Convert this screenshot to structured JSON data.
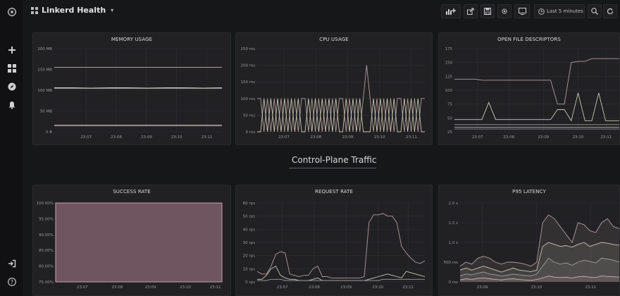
{
  "app": {
    "dashboard_title": "Linkerd Health",
    "time_picker_label": "Last 5 minutes"
  },
  "colors": {
    "background": "#161719",
    "panel": "#212124",
    "line_primary": "#b89a9a",
    "line_secondary": "#c9c9b0",
    "line_tertiary": "#9e9e9e",
    "success_fill": "#6e5560"
  },
  "icons": {
    "sidebar_top": "grafana-logo-icon",
    "sidebar": [
      "plus-icon",
      "dashboards-icon",
      "explore-compass-icon",
      "bell-alert-icon"
    ],
    "sidebar_bottom": [
      "sign-in-icon",
      "help-icon"
    ],
    "navbar": [
      "add-panel-icon",
      "share-icon",
      "save-icon",
      "settings-gear-icon",
      "tv-mode-icon",
      "clock-icon",
      "zoom-out-icon",
      "refresh-icon"
    ]
  },
  "row": {
    "title": "Control-Plane Traffic"
  },
  "panels": [
    {
      "title": "MEMORY USAGE",
      "chart_data": {
        "type": "line",
        "x_ticks": [
          "23:07",
          "23:08",
          "23:09",
          "23:10",
          "23:11"
        ],
        "y_ticks": [
          "0 B",
          "50 MB",
          "100 MB",
          "150 MB",
          "200 MB"
        ],
        "ylim": [
          0,
          200
        ],
        "series": [
          {
            "values": [
              155,
              155,
              155,
              155,
              155,
              155,
              155,
              155,
              155,
              155
            ]
          },
          {
            "values": [
              106,
              106,
              105,
              106,
              106,
              105,
              106,
              106,
              105,
              106
            ]
          },
          {
            "values": [
              104,
              104,
              104,
              104,
              104,
              104,
              104,
              104,
              104,
              104
            ]
          },
          {
            "values": [
              16,
              16,
              16,
              16,
              16,
              16,
              16,
              16,
              16,
              16
            ]
          },
          {
            "values": [
              14,
              14,
              14,
              14,
              14,
              14,
              14,
              14,
              14,
              14
            ]
          }
        ]
      }
    },
    {
      "title": "CPU USAGE",
      "chart_data": {
        "type": "line",
        "x_ticks": [
          "23:07",
          "23:08",
          "23:09",
          "23:10",
          "23:11"
        ],
        "y_ticks": [
          "0 ms",
          "50 ms",
          "100 ms",
          "150 ms",
          "200 ms",
          "250 ms"
        ],
        "ylim": [
          0,
          250
        ],
        "series": [
          {
            "values": [
              100,
              100,
              0,
              100,
              0,
              100,
              0,
              100,
              0,
              100,
              0,
              100,
              0,
              100,
              100,
              0,
              100,
              0,
              100,
              0,
              100,
              0,
              100,
              0,
              100,
              100,
              0,
              100,
              0,
              100,
              0,
              100,
              200,
              100,
              0,
              100,
              0,
              100,
              0,
              100,
              0,
              100,
              100,
              0,
              100,
              0,
              100,
              0,
              100,
              100
            ]
          },
          {
            "values": [
              0,
              0,
              100,
              0,
              100,
              0,
              100,
              0,
              100,
              0,
              100,
              0,
              100,
              0,
              0,
              100,
              0,
              100,
              0,
              100,
              0,
              100,
              0,
              100,
              0,
              0,
              100,
              0,
              100,
              0,
              100,
              0,
              0,
              0,
              100,
              0,
              100,
              0,
              100,
              0,
              100,
              0,
              0,
              100,
              0,
              100,
              0,
              100,
              0,
              0
            ]
          }
        ]
      }
    },
    {
      "title": "OPEN FILE DESCRIPTORS",
      "chart_data": {
        "type": "line",
        "x_ticks": [
          "23:07",
          "23:08",
          "23:09",
          "23:10",
          "23:11"
        ],
        "y_ticks": [
          "25",
          "50",
          "75",
          "100",
          "125",
          "150",
          "175"
        ],
        "ylim": [
          25,
          175
        ],
        "series": [
          {
            "values": [
              120,
              120,
              120,
              120,
              118,
              118,
              118,
              118,
              118,
              118,
              118,
              118,
              118,
              118,
              118,
              75,
              75,
              150,
              152,
              152,
              157,
              157,
              157,
              157,
              157
            ]
          },
          {
            "values": [
              47,
              47,
              47,
              47,
              47,
              78,
              47,
              47,
              47,
              47,
              47,
              47,
              47,
              47,
              47,
              65,
              65,
              45,
              95,
              45,
              45,
              95,
              45,
              45,
              45
            ]
          },
          {
            "values": [
              38,
              38,
              38,
              38,
              38,
              38,
              38,
              38,
              38,
              38,
              38,
              38,
              38,
              38,
              38,
              38,
              38,
              38,
              38,
              38,
              38,
              38,
              38,
              38,
              38
            ]
          },
          {
            "values": [
              33,
              33,
              33,
              33,
              33,
              33,
              33,
              33,
              33,
              33,
              33,
              33,
              33,
              33,
              33,
              33,
              33,
              33,
              33,
              33,
              33,
              33,
              33,
              33,
              33
            ]
          },
          {
            "values": [
              30,
              30,
              30,
              30,
              30,
              30,
              30,
              30,
              30,
              30,
              30,
              30,
              30,
              30,
              30,
              30,
              30,
              30,
              30,
              30,
              30,
              30,
              30,
              30,
              30
            ]
          }
        ]
      }
    },
    {
      "title": "SUCCESS RATE",
      "chart_data": {
        "type": "area",
        "x_ticks": [
          "23:07",
          "23:08",
          "23:09",
          "23:10",
          "23:11"
        ],
        "y_ticks": [
          "75.00%",
          "80.00%",
          "85.00%",
          "90.00%",
          "95.00%",
          "100.00%"
        ],
        "ylim": [
          75,
          100
        ],
        "series": [
          {
            "values": [
              100,
              100,
              100,
              100,
              100,
              100,
              100,
              100,
              100,
              100
            ]
          }
        ]
      }
    },
    {
      "title": "REQUEST RATE",
      "chart_data": {
        "type": "line",
        "x_ticks": [
          "23:07",
          "23:08",
          "23:09",
          "23:10",
          "23:11"
        ],
        "y_ticks": [
          "0 rps",
          "10 rps",
          "20 rps",
          "30 rps",
          "40 rps",
          "50 rps",
          "60 rps"
        ],
        "ylim": [
          0,
          60
        ],
        "series": [
          {
            "values": [
              8,
              6,
              6,
              12,
              21,
              23,
              22,
              6,
              5,
              4,
              5,
              5,
              10,
              12,
              4,
              4,
              3,
              3,
              3,
              3,
              3,
              3,
              3,
              4,
              45,
              51,
              51,
              52,
              50,
              50,
              45,
              27,
              22,
              18,
              15,
              14,
              16
            ]
          },
          {
            "values": [
              2,
              2,
              5,
              10,
              12,
              5,
              3,
              2,
              2,
              1,
              1,
              1,
              2,
              3,
              1,
              1,
              1,
              1,
              1,
              1,
              1,
              1,
              1,
              1,
              2,
              3,
              4,
              5,
              6,
              5,
              4,
              3,
              8,
              7,
              6,
              5,
              4
            ]
          },
          {
            "values": [
              1,
              1,
              1,
              2,
              2,
              2,
              1,
              1,
              1,
              1,
              1,
              1,
              1,
              1,
              1,
              1,
              1,
              1,
              1,
              1,
              1,
              1,
              1,
              1,
              1,
              1,
              1,
              2,
              2,
              2,
              2,
              2,
              2,
              2,
              2,
              2,
              2
            ]
          }
        ]
      }
    },
    {
      "title": "P95 LATENCY",
      "chart_data": {
        "type": "line",
        "x_ticks": [
          "23:09",
          "23:10",
          "23:11"
        ],
        "y_ticks": [
          "0 ms",
          "500 ms",
          "1.0 s",
          "1.5 s",
          "2.0 s"
        ],
        "ylim": [
          0,
          2000
        ],
        "series": [
          {
            "values": [
              400,
              500,
              450,
              600,
              650,
              600,
              500,
              450,
              500,
              500,
              480,
              450,
              400,
              500,
              1500,
              1700,
              1600,
              1400,
              1200,
              1000,
              1500,
              1450,
              1300,
              1250,
              1500,
              1600,
              1400,
              1350
            ]
          },
          {
            "values": [
              300,
              350,
              300,
              350,
              400,
              350,
              300,
              250,
              300,
              350,
              300,
              280,
              260,
              300,
              900,
              1000,
              950,
              900,
              920,
              880,
              950,
              1000,
              900,
              950,
              1000,
              980,
              950,
              930
            ]
          },
          {
            "values": [
              150,
              200,
              180,
              220,
              250,
              200,
              180,
              150,
              170,
              200,
              180,
              160,
              150,
              200,
              400,
              600,
              500,
              450,
              480,
              420,
              500,
              550,
              520,
              480,
              600,
              580,
              550,
              500
            ]
          },
          {
            "values": [
              50,
              80,
              60,
              90,
              100,
              80,
              60,
              50,
              70,
              80,
              60,
              50,
              40,
              60,
              100,
              150,
              120,
              110,
              120,
              100,
              130,
              140,
              120,
              110,
              150,
              140,
              130,
              120
            ]
          }
        ]
      }
    }
  ]
}
